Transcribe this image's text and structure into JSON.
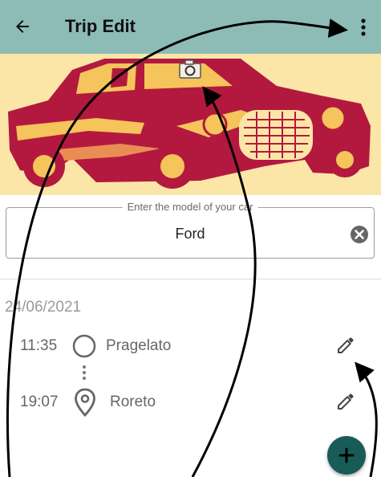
{
  "appbar": {
    "title": "Trip Edit",
    "back_icon": "arrow-back-icon",
    "menu_icon": "more-vert-icon",
    "color": "#8dbcb7"
  },
  "banner": {
    "image": "vintage-car-illustration",
    "camera_icon": "camera-icon",
    "colors": {
      "background": "#fbe6a7",
      "car": "#b3193f",
      "highlight": "#f5c45a"
    }
  },
  "car_model": {
    "label": "Enter the model of your car",
    "value": "Ford",
    "clear_icon": "clear-circle-icon"
  },
  "trip": {
    "date": "24/06/2021",
    "stops": [
      {
        "time": "11:35",
        "place": "Pragelato",
        "icon": "circle-outline-icon",
        "edit_icon": "pencil-icon"
      },
      {
        "time": "19:07",
        "place": "Roreto",
        "icon": "location-pin-icon",
        "edit_icon": "pencil-icon"
      }
    ]
  },
  "fab": {
    "icon": "plus-icon",
    "color": "#195b57"
  }
}
